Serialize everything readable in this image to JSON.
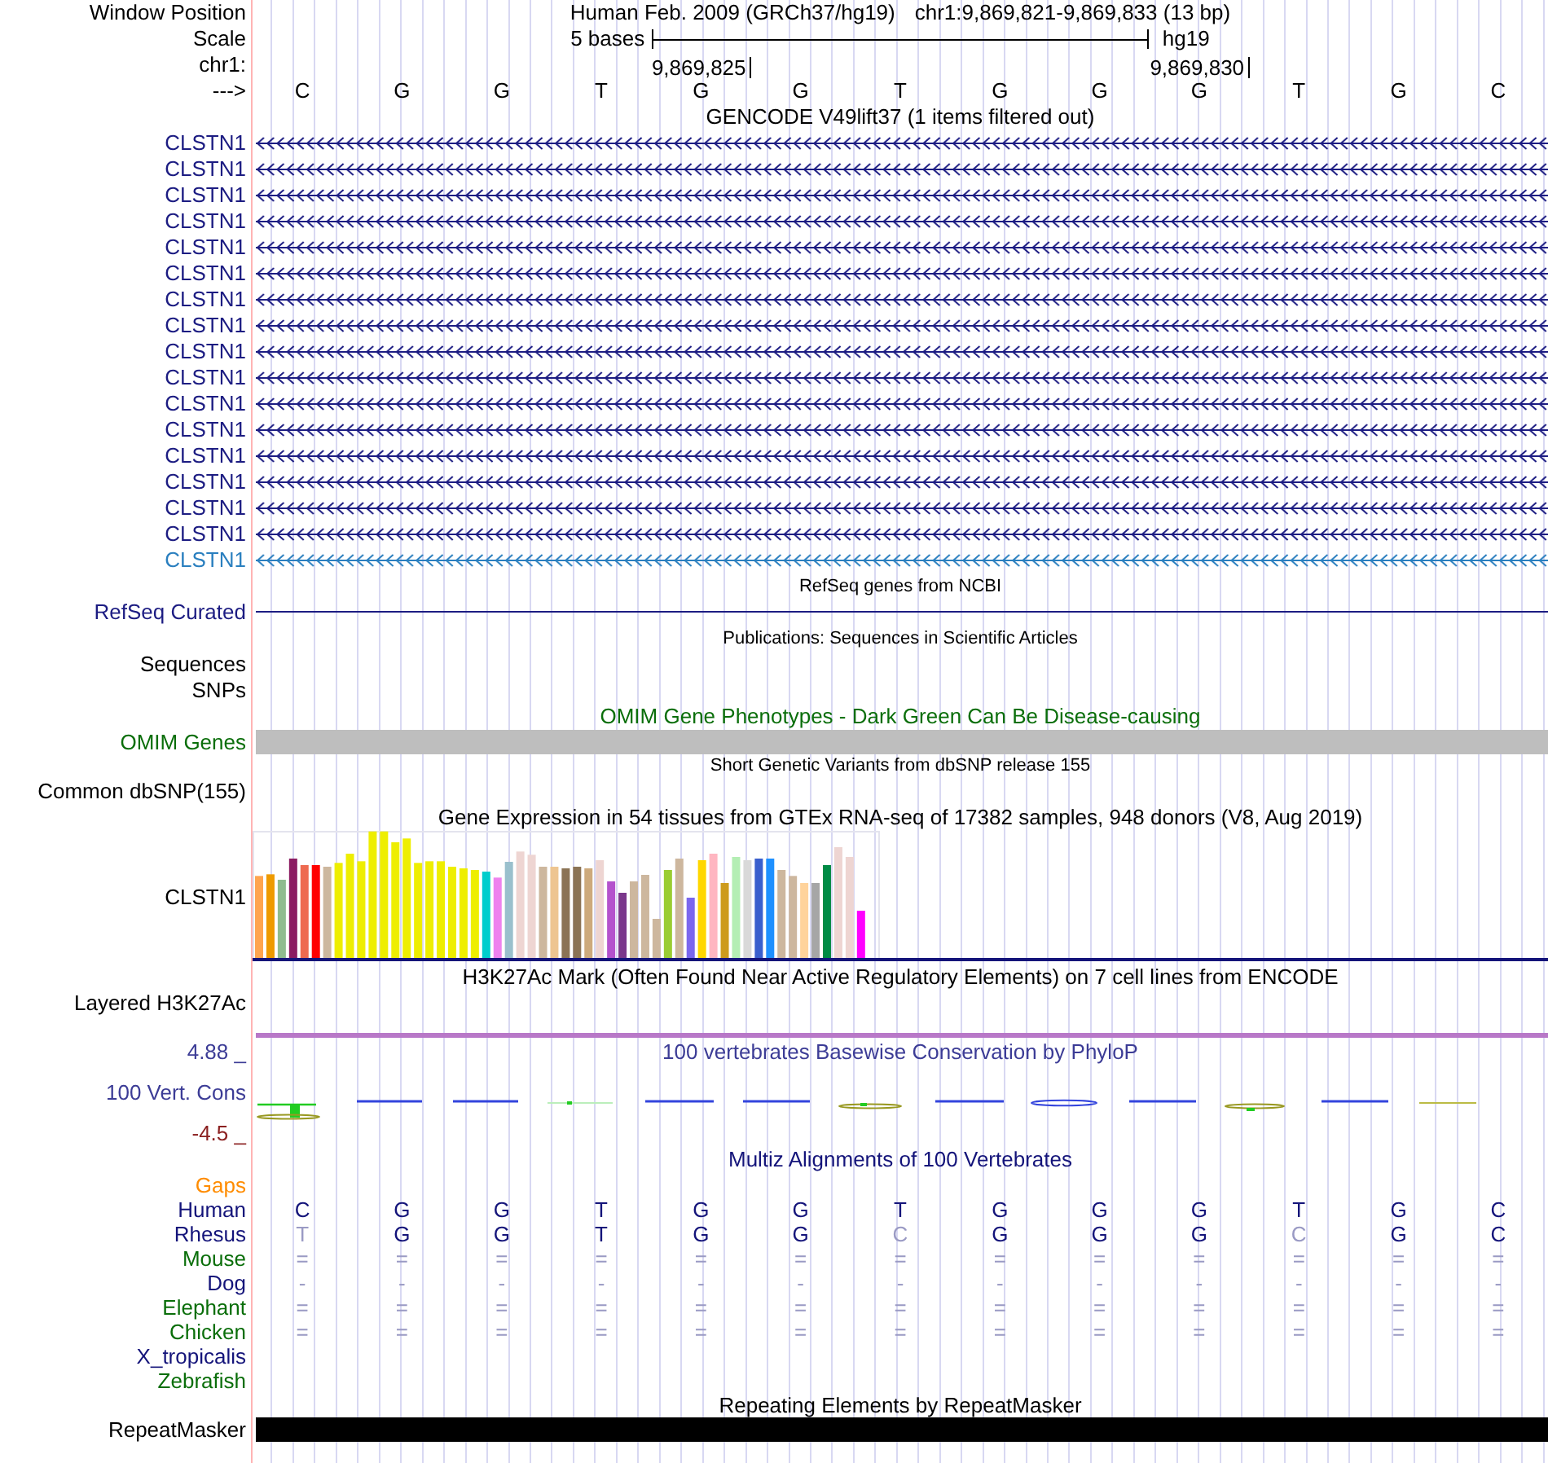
{
  "rows": [
    {
      "kind": "position",
      "label": "Window Position",
      "assembly": "Human Feb. 2009 (GRCh37/hg19)",
      "range": "chr1:9,869,821-9,869,833 (13 bp)"
    },
    {
      "kind": "scale",
      "label": "Scale",
      "size": "5 bases",
      "db": "hg19"
    },
    {
      "kind": "coords",
      "label": "chr1:",
      "ticks": [
        "9,869,825",
        "9,869,830"
      ]
    },
    {
      "kind": "bases",
      "label": "--->",
      "bases": [
        "C",
        "G",
        "G",
        "T",
        "G",
        "G",
        "T",
        "G",
        "G",
        "G",
        "T",
        "G",
        "C"
      ]
    },
    {
      "kind": "title",
      "text": "GENCODE V49lift37 (1 items filtered out)",
      "small": false,
      "color": "#000000"
    },
    {
      "kind": "genes",
      "items": [
        {
          "label": "CLSTN1",
          "color": "#1c1c82"
        },
        {
          "label": "CLSTN1",
          "color": "#1c1c82"
        },
        {
          "label": "CLSTN1",
          "color": "#1c1c82"
        },
        {
          "label": "CLSTN1",
          "color": "#1c1c82"
        },
        {
          "label": "CLSTN1",
          "color": "#1c1c82"
        },
        {
          "label": "CLSTN1",
          "color": "#1c1c82"
        },
        {
          "label": "CLSTN1",
          "color": "#1c1c82"
        },
        {
          "label": "CLSTN1",
          "color": "#1c1c82"
        },
        {
          "label": "CLSTN1",
          "color": "#1c1c82"
        },
        {
          "label": "CLSTN1",
          "color": "#1c1c82"
        },
        {
          "label": "CLSTN1",
          "color": "#1c1c82"
        },
        {
          "label": "CLSTN1",
          "color": "#1c1c82"
        },
        {
          "label": "CLSTN1",
          "color": "#1c1c82"
        },
        {
          "label": "CLSTN1",
          "color": "#1c1c82"
        },
        {
          "label": "CLSTN1",
          "color": "#1c1c82"
        },
        {
          "label": "CLSTN1",
          "color": "#1c1c82"
        },
        {
          "label": "CLSTN1",
          "color": "#2a7fbf"
        }
      ]
    },
    {
      "kind": "title",
      "text": "RefSeq genes from NCBI",
      "small": true,
      "color": "#000000"
    },
    {
      "kind": "line_track",
      "label": "RefSeq Curated",
      "color": "#1c1c82"
    },
    {
      "kind": "title",
      "text": "Publications: Sequences in Scientific Articles",
      "small": true,
      "color": "#000000"
    },
    {
      "kind": "label",
      "label": "Sequences",
      "color": "#000000"
    },
    {
      "kind": "label",
      "label": "SNPs",
      "color": "#000000"
    },
    {
      "kind": "title",
      "text": "OMIM Gene Phenotypes - Dark Green Can Be Disease-causing",
      "small": false,
      "color": "#0a6e0a"
    },
    {
      "kind": "bar_track",
      "label": "OMIM Genes",
      "color": "#0a6e0a",
      "bar": {
        "color": "#bebebe"
      }
    },
    {
      "kind": "title",
      "text": "Short Genetic Variants from dbSNP release 155",
      "small": true,
      "color": "#000000"
    },
    {
      "kind": "label",
      "label": "Common dbSNP(155)",
      "color": "#000000"
    },
    {
      "kind": "title",
      "text": "Gene Expression in 54 tissues from GTEx RNA-seq of 17382 samples, 948 donors (V8, Aug 2019)",
      "small": false,
      "color": "#000000"
    },
    {
      "kind": "expression",
      "label": "CLSTN1",
      "color": "#000000"
    },
    {
      "kind": "title",
      "text": "H3K27Ac Mark (Often Found Near Active Regulatory Elements) on 7 cell lines from ENCODE",
      "small": false,
      "color": "#000000"
    },
    {
      "kind": "layered",
      "label": "Layered H3K27Ac",
      "color": "#000000"
    },
    {
      "kind": "conservation",
      "max": "4.88 _",
      "label": "100 Vert. Cons",
      "min": {
        "text": "-4.5 _",
        "color": "#8b2020"
      },
      "title": "100 vertebrates Basewise Conservation by PhyloP",
      "color": "#3c3c96"
    },
    {
      "kind": "title",
      "text": "Multiz Alignments of 100 Vertebrates",
      "small": false,
      "color": "#14147a"
    },
    {
      "kind": "alignment",
      "species": [
        {
          "name": "Gaps",
          "color": "#ff8c00"
        },
        {
          "name": "Human",
          "color": "#14147a",
          "bases": [
            {
              "base": "C",
              "faded": false
            },
            {
              "base": "G",
              "faded": false
            },
            {
              "base": "G",
              "faded": false
            },
            {
              "base": "T",
              "faded": false
            },
            {
              "base": "G",
              "faded": false
            },
            {
              "base": "G",
              "faded": false
            },
            {
              "base": "T",
              "faded": false
            },
            {
              "base": "G",
              "faded": false
            },
            {
              "base": "G",
              "faded": false
            },
            {
              "base": "G",
              "faded": false
            },
            {
              "base": "T",
              "faded": false
            },
            {
              "base": "G",
              "faded": false
            },
            {
              "base": "C",
              "faded": false
            }
          ]
        },
        {
          "name": "Rhesus",
          "color": "#14147a",
          "bases": [
            {
              "base": "T",
              "faded": true
            },
            {
              "base": "G",
              "faded": false
            },
            {
              "base": "G",
              "faded": false
            },
            {
              "base": "T",
              "faded": false
            },
            {
              "base": "G",
              "faded": false
            },
            {
              "base": "G",
              "faded": false
            },
            {
              "base": "C",
              "faded": true
            },
            {
              "base": "G",
              "faded": false
            },
            {
              "base": "G",
              "faded": false
            },
            {
              "base": "G",
              "faded": false
            },
            {
              "base": "C",
              "faded": true
            },
            {
              "base": "G",
              "faded": false
            },
            {
              "base": "C",
              "faded": false
            }
          ]
        },
        {
          "name": "Mouse",
          "color": "#0a6e0a",
          "bases": [
            {
              "base": "=",
              "faded": true
            },
            {
              "base": "=",
              "faded": true
            },
            {
              "base": "=",
              "faded": true
            },
            {
              "base": "=",
              "faded": true
            },
            {
              "base": "=",
              "faded": true
            },
            {
              "base": "=",
              "faded": true
            },
            {
              "base": "=",
              "faded": true
            },
            {
              "base": "=",
              "faded": true
            },
            {
              "base": "=",
              "faded": true
            },
            {
              "base": "=",
              "faded": true
            },
            {
              "base": "=",
              "faded": true
            },
            {
              "base": "=",
              "faded": true
            },
            {
              "base": "=",
              "faded": true
            }
          ]
        },
        {
          "name": "Dog",
          "color": "#14147a",
          "bases": [
            {
              "base": "-",
              "faded": true
            },
            {
              "base": "-",
              "faded": true
            },
            {
              "base": "-",
              "faded": true
            },
            {
              "base": "-",
              "faded": true
            },
            {
              "base": "-",
              "faded": true
            },
            {
              "base": "-",
              "faded": true
            },
            {
              "base": "-",
              "faded": true
            },
            {
              "base": "-",
              "faded": true
            },
            {
              "base": "-",
              "faded": true
            },
            {
              "base": "-",
              "faded": true
            },
            {
              "base": "-",
              "faded": true
            },
            {
              "base": "-",
              "faded": true
            },
            {
              "base": "-",
              "faded": true
            }
          ]
        },
        {
          "name": "Elephant",
          "color": "#0a6e0a",
          "bases": [
            {
              "base": "=",
              "faded": true
            },
            {
              "base": "=",
              "faded": true
            },
            {
              "base": "=",
              "faded": true
            },
            {
              "base": "=",
              "faded": true
            },
            {
              "base": "=",
              "faded": true
            },
            {
              "base": "=",
              "faded": true
            },
            {
              "base": "=",
              "faded": true
            },
            {
              "base": "=",
              "faded": true
            },
            {
              "base": "=",
              "faded": true
            },
            {
              "base": "=",
              "faded": true
            },
            {
              "base": "=",
              "faded": true
            },
            {
              "base": "=",
              "faded": true
            },
            {
              "base": "=",
              "faded": true
            }
          ]
        },
        {
          "name": "Chicken",
          "color": "#0a6e0a",
          "bases": [
            {
              "base": "=",
              "faded": true
            },
            {
              "base": "=",
              "faded": true
            },
            {
              "base": "=",
              "faded": true
            },
            {
              "base": "=",
              "faded": true
            },
            {
              "base": "=",
              "faded": true
            },
            {
              "base": "=",
              "faded": true
            },
            {
              "base": "=",
              "faded": true
            },
            {
              "base": "=",
              "faded": true
            },
            {
              "base": "=",
              "faded": true
            },
            {
              "base": "=",
              "faded": true
            },
            {
              "base": "=",
              "faded": true
            },
            {
              "base": "=",
              "faded": true
            },
            {
              "base": "=",
              "faded": true
            }
          ]
        },
        {
          "name": "X_tropicalis",
          "color": "#14147a"
        },
        {
          "name": "Zebrafish",
          "color": "#0a6e0a"
        }
      ]
    },
    {
      "kind": "title",
      "text": "Repeating Elements by RepeatMasker",
      "small": false,
      "color": "#000000"
    },
    {
      "kind": "bar_track",
      "label": "RepeatMasker",
      "color": "#000000",
      "bar": {
        "color": "#000000"
      }
    }
  ]
}
